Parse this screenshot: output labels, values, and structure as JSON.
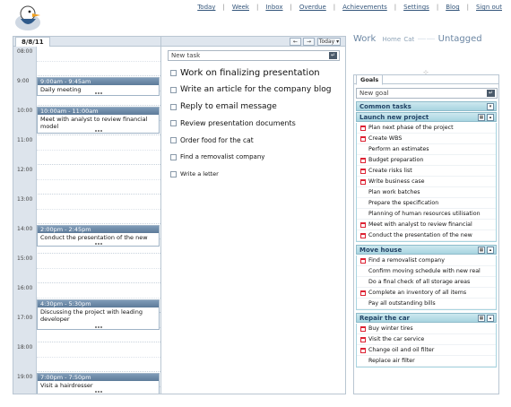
{
  "nav": [
    "Today",
    "Week",
    "Inbox",
    "Overdue",
    "Achievements",
    "Settings",
    "Blog",
    "Sign out"
  ],
  "calendar": {
    "date_tab": "8/8/11",
    "hours": [
      "08:00",
      "9:00",
      "10:00",
      "11:00",
      "12:00",
      "13:00",
      "14:00",
      "15:00",
      "16:00",
      "17:00",
      "18:00",
      "19:00"
    ],
    "events": [
      {
        "time": "9:00am - 9:45am",
        "title": "Daily meeting"
      },
      {
        "time": "10:00am - 11:00am",
        "title": "Meet with analyst to review financial model"
      },
      {
        "time": "2:00pm - 2:45pm",
        "title": "Conduct the presentation of the new"
      },
      {
        "time": "4:30pm - 5:30pm",
        "title": "Discussing the project with leading developer"
      },
      {
        "time": "7:00pm - 7:50pm",
        "title": "Visit a hairdresser"
      }
    ]
  },
  "tasks_panel": {
    "prev": "←",
    "next": "→",
    "today": "Today ▾",
    "new_task_value": "New task",
    "enter": "↵",
    "tasks": [
      "Work on finalizing presentation",
      "Write an article for the company blog",
      "Reply to email message",
      "Review presentation documents",
      "Order food for the cat",
      "Find a removalist company",
      "Write a letter"
    ]
  },
  "context": {
    "work": "Work",
    "home": "Home",
    "cat": "Cat",
    "untagged": "Untagged"
  },
  "goals": {
    "tab": "Goals",
    "pin": "⊹",
    "new_goal_value": "New goal",
    "enter": "↵",
    "sections": [
      {
        "title": "Common tasks",
        "items": []
      },
      {
        "title": "Launch new project",
        "items": [
          {
            "label": "Plan next phase of the project",
            "scheduled": true
          },
          {
            "label": "Create WBS",
            "scheduled": true
          },
          {
            "label": "Perform an estimates",
            "scheduled": false
          },
          {
            "label": "Budget preparation",
            "scheduled": true
          },
          {
            "label": "Create risks list",
            "scheduled": true
          },
          {
            "label": "Write business case",
            "scheduled": true
          },
          {
            "label": "Plan work batches",
            "scheduled": false
          },
          {
            "label": "Prepare the specification",
            "scheduled": false
          },
          {
            "label": "Planning of human resources utilisation",
            "scheduled": false
          },
          {
            "label": "Meet with analyst to review financial",
            "scheduled": true
          },
          {
            "label": "Conduct the presentation of the new",
            "scheduled": true
          }
        ]
      },
      {
        "title": "Move house",
        "items": [
          {
            "label": "Find a removalist company",
            "scheduled": true
          },
          {
            "label": "Confirm moving schedule with new real",
            "scheduled": false
          },
          {
            "label": "Do a final check of all storage areas",
            "scheduled": false
          },
          {
            "label": "Complete an inventory of all items",
            "scheduled": true
          },
          {
            "label": "Pay all outstanding bills",
            "scheduled": false
          }
        ]
      },
      {
        "title": "Repair the car",
        "items": [
          {
            "label": "Buy winter tires",
            "scheduled": true
          },
          {
            "label": "Visit the car service",
            "scheduled": true
          },
          {
            "label": "Change oil and oil filter",
            "scheduled": true
          },
          {
            "label": "Replace air filter",
            "scheduled": false
          }
        ]
      }
    ]
  }
}
